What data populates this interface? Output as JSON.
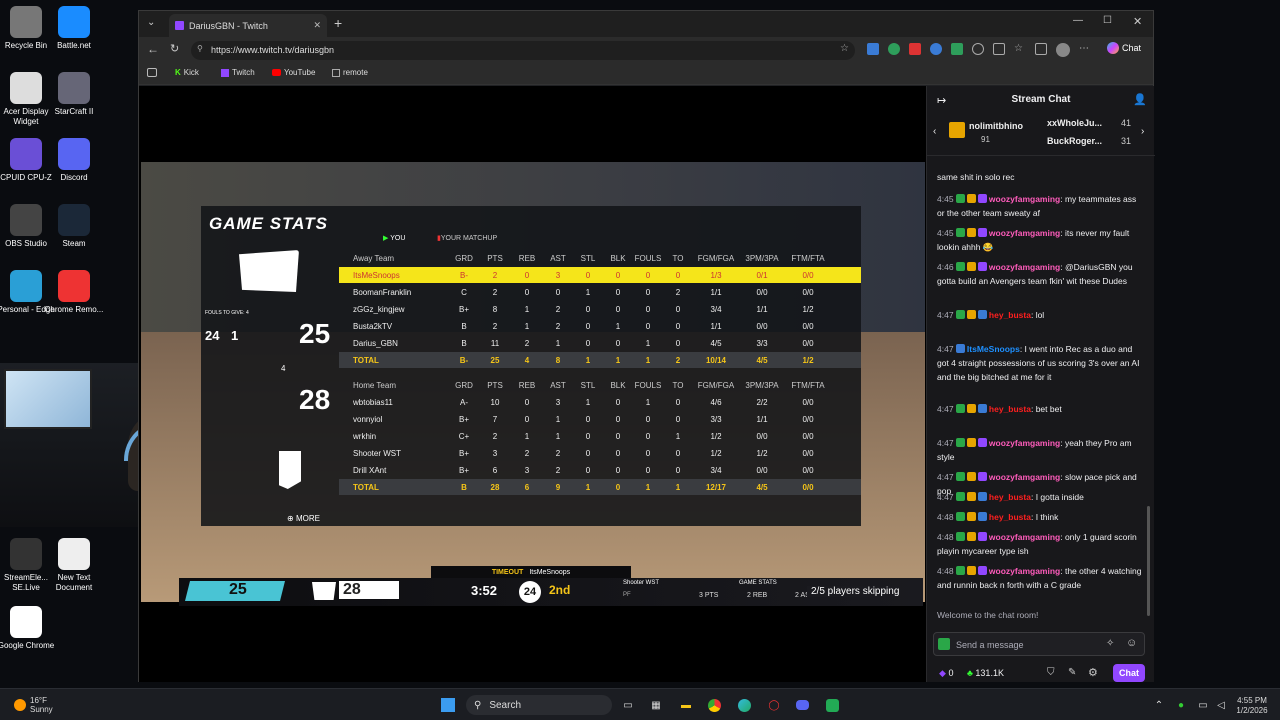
{
  "desktop": {
    "icons": [
      {
        "label": "Recycle Bin",
        "icon": "recycle-bin-icon"
      },
      {
        "label": "Battle.net",
        "icon": "battlenet-icon"
      },
      {
        "label": "Acer Display Widget",
        "icon": "acer-icon"
      },
      {
        "label": "StarCraft II",
        "icon": "starcraft-icon"
      },
      {
        "label": "CPUID CPU-Z",
        "icon": "cpuz-icon"
      },
      {
        "label": "Discord",
        "icon": "discord-icon"
      },
      {
        "label": "OBS Studio",
        "icon": "obs-icon"
      },
      {
        "label": "Steam",
        "icon": "steam-icon"
      },
      {
        "label": "Personal - Edge",
        "icon": "edge-icon"
      },
      {
        "label": "Chrome Remo...",
        "icon": "chrome-remote-icon"
      },
      {
        "label": "StreamEle... SE.Live",
        "icon": "streamelements-icon"
      },
      {
        "label": "New Text Document",
        "icon": "text-document-icon"
      },
      {
        "label": "Google Chrome",
        "icon": "chrome-icon"
      }
    ]
  },
  "browser": {
    "tab_title": "DariusGBN - Twitch",
    "url": "https://www.twitch.tv/dariusgbn",
    "chat_button": "Chat",
    "bookmarks": [
      "Kick",
      "Twitch",
      "YouTube",
      "remote"
    ]
  },
  "game": {
    "title": "GAME STATS",
    "tab_you": "YOU",
    "tab_matchup": "YOUR MATCHUP",
    "fouls_label": "FOULS TO GIVE: 4",
    "shot_clock": "24",
    "timeouts": "1",
    "away_score": "25",
    "home_score": "28",
    "home_fouls": "4",
    "more": "MORE",
    "columns": [
      "GRD",
      "PTS",
      "REB",
      "AST",
      "STL",
      "BLK",
      "FOULS",
      "TO",
      "FGM/FGA",
      "3PM/3PA",
      "FTM/FTA"
    ],
    "away_header": "Away Team",
    "home_header": "Home Team",
    "away_rows": [
      [
        "ItsMeSnoops",
        "B-",
        "2",
        "0",
        "3",
        "0",
        "0",
        "0",
        "0",
        "1/3",
        "0/1",
        "0/0"
      ],
      [
        "BoomanFranklin",
        "C",
        "2",
        "0",
        "0",
        "1",
        "0",
        "0",
        "2",
        "1/1",
        "0/0",
        "0/0"
      ],
      [
        "zGGz_kingjew",
        "B+",
        "8",
        "1",
        "2",
        "0",
        "0",
        "0",
        "0",
        "3/4",
        "1/1",
        "1/2"
      ],
      [
        "Busta2kTV",
        "B",
        "2",
        "1",
        "2",
        "0",
        "1",
        "0",
        "0",
        "1/1",
        "0/0",
        "0/0"
      ],
      [
        "Darius_GBN",
        "B",
        "11",
        "2",
        "1",
        "0",
        "0",
        "1",
        "0",
        "4/5",
        "3/3",
        "0/0"
      ]
    ],
    "away_total": [
      "TOTAL",
      "B-",
      "25",
      "4",
      "8",
      "1",
      "1",
      "1",
      "2",
      "10/14",
      "4/5",
      "1/2"
    ],
    "home_rows": [
      [
        "wbtobias11",
        "A-",
        "10",
        "0",
        "3",
        "1",
        "0",
        "1",
        "0",
        "4/6",
        "2/2",
        "0/0"
      ],
      [
        "vonnyiol",
        "B+",
        "7",
        "0",
        "1",
        "0",
        "0",
        "0",
        "0",
        "3/3",
        "1/1",
        "0/0"
      ],
      [
        "wrkhin",
        "C+",
        "2",
        "1",
        "1",
        "0",
        "0",
        "0",
        "1",
        "1/2",
        "0/0",
        "0/0"
      ],
      [
        "Shooter WST",
        "B+",
        "3",
        "2",
        "2",
        "0",
        "0",
        "0",
        "0",
        "1/2",
        "1/2",
        "0/0"
      ],
      [
        "Drill XAnt",
        "B+",
        "6",
        "3",
        "2",
        "0",
        "0",
        "0",
        "0",
        "3/4",
        "0/0",
        "0/0"
      ]
    ],
    "home_total": [
      "TOTAL",
      "B",
      "28",
      "6",
      "9",
      "1",
      "0",
      "1",
      "1",
      "12/17",
      "4/5",
      "0/0"
    ],
    "timeout_banner": "TIMEOUT",
    "timeout_player": "ItsMeSnoops",
    "bottom_away": "25",
    "bottom_home": "28",
    "game_clock": "3:52",
    "bottom_shot": "24",
    "quarter": "2nd",
    "bottom_player": "Shooter WST",
    "bottom_pos": "PF",
    "bottom_stats_title": "GAME STATS",
    "bottom_stats": [
      "3 PTS",
      "2 REB",
      "2 AST"
    ],
    "skipping": "2/5 players skipping"
  },
  "chat": {
    "header": "Stream Chat",
    "gift_user1": "nolimitbhino",
    "gift_count1": "91",
    "gift_user2": "xxWholeJu...",
    "gift_count2": "41",
    "gift_user3": "BuckRoger...",
    "gift_count3": "31",
    "partial_line": "same shit in solo rec",
    "messages": [
      {
        "time": "4:45",
        "user": "woozyfamgaming",
        "color": "p",
        "text": ": my teammates ass or the other team sweaty af"
      },
      {
        "time": "4:45",
        "user": "woozyfamgaming",
        "color": "p",
        "text": ": its never my fault lookin ahhh 😂"
      },
      {
        "time": "4:46",
        "user": "woozyfamgaming",
        "color": "p",
        "text": ": @DariusGBN  you gotta build an Avengers team fkin' wit these Dudes"
      },
      {
        "time": "4:47",
        "user": "hey_busta",
        "color": "r",
        "text": ": lol"
      },
      {
        "time": "4:47",
        "user": "ItsMeSnoops",
        "color": "b",
        "text": ": I went into Rec as a duo and got 4 straight possessions of us scoring 3's over an AI and the big bitched at me for it"
      },
      {
        "time": "4:47",
        "user": "hey_busta",
        "color": "r",
        "text": ": bet bet"
      },
      {
        "time": "4:47",
        "user": "woozyfamgaming",
        "color": "p",
        "text": ": yeah they Pro am style"
      },
      {
        "time": "4:47",
        "user": "woozyfamgaming",
        "color": "p",
        "text": ": slow pace pick and pop"
      },
      {
        "time": "4:47",
        "user": "hey_busta",
        "color": "r",
        "text": ": I gotta inside"
      },
      {
        "time": "4:48",
        "user": "hey_busta",
        "color": "r",
        "text": ": I think"
      },
      {
        "time": "4:48",
        "user": "woozyfamgaming",
        "color": "p",
        "text": ": only 1 guard scorin playin mycareer type ish"
      },
      {
        "time": "4:48",
        "user": "woozyfamgaming",
        "color": "p",
        "text": ": the other 4 watching and runnin back n forth with a C grade"
      }
    ],
    "welcome": "Welcome to the chat room!",
    "input_placeholder": "Send a message",
    "points": "0",
    "bits": "131.1K",
    "send_label": "Chat"
  },
  "taskbar": {
    "weather_temp": "16°F",
    "weather_desc": "Sunny",
    "search": "Search",
    "time": "4:55 PM",
    "date": "1/2/2026"
  },
  "colors": {
    "twitch_purple": "#9147ff",
    "stat_highlight": "#f5e51a",
    "total_gold": "#f5c518"
  }
}
